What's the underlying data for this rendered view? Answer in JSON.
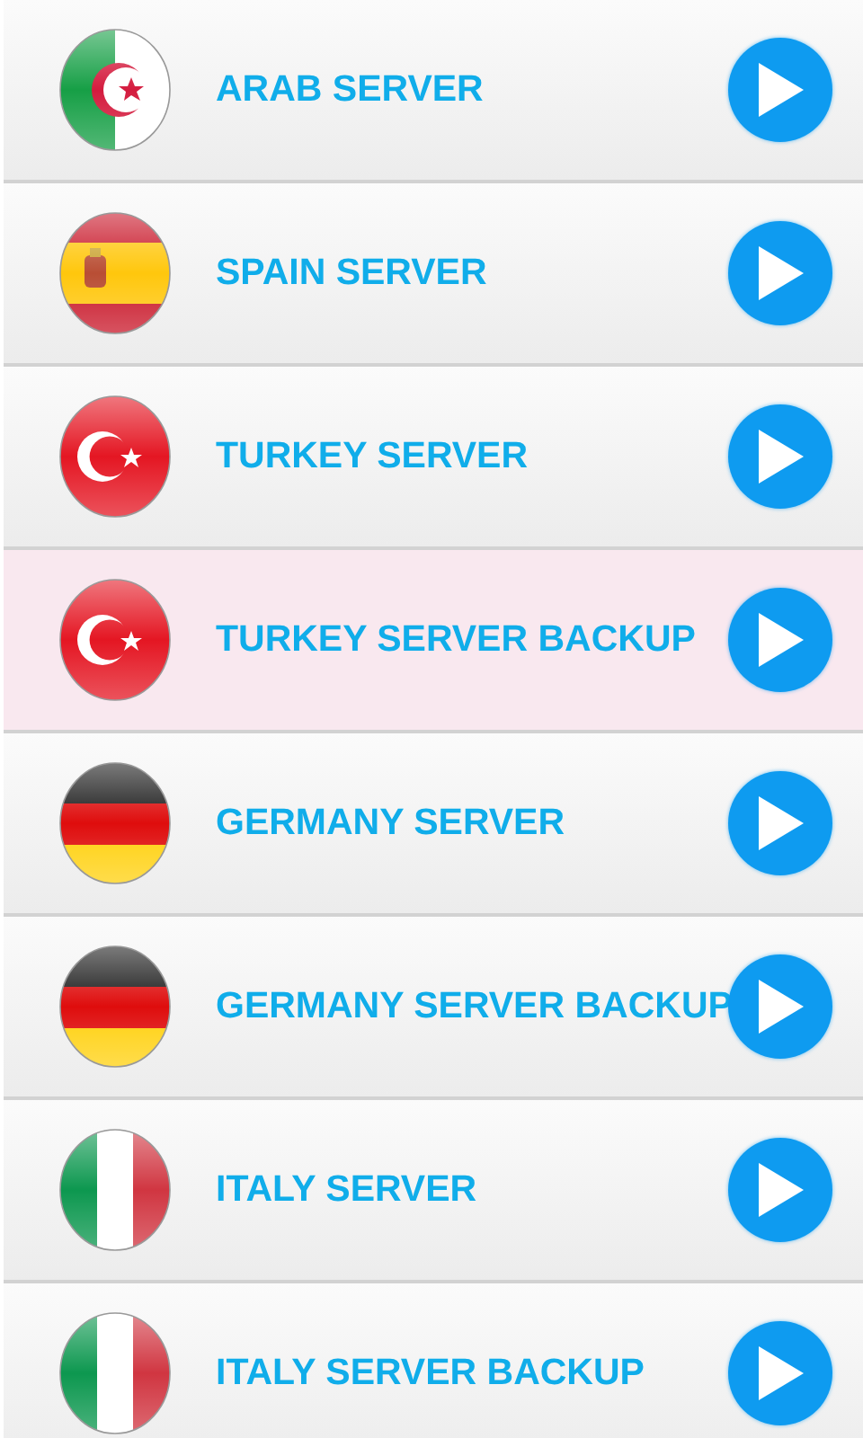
{
  "servers": [
    {
      "kind": "algeria",
      "label": "ARAB SERVER",
      "selected": false
    },
    {
      "kind": "spain",
      "label": "SPAIN SERVER",
      "selected": false
    },
    {
      "kind": "turkey",
      "label": "TURKEY SERVER",
      "selected": false
    },
    {
      "kind": "turkey",
      "label": "TURKEY SERVER BACKUP",
      "selected": true
    },
    {
      "kind": "germany",
      "label": "GERMANY SERVER",
      "selected": false
    },
    {
      "kind": "germany",
      "label": "GERMANY SERVER BACKUP",
      "selected": false
    },
    {
      "kind": "italy",
      "label": "ITALY SERVER",
      "selected": false
    },
    {
      "kind": "italy",
      "label": "ITALY SERVER BACKUP",
      "selected": false
    }
  ]
}
